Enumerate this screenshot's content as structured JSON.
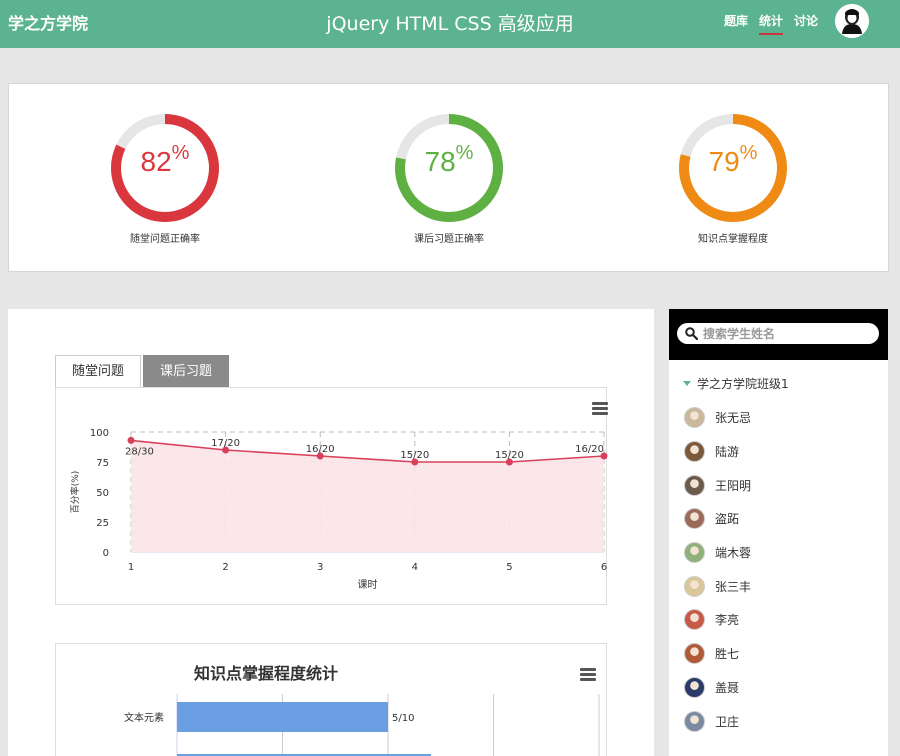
{
  "header": {
    "brand": "学之方学院",
    "title": "jQuery HTML CSS 高级应用",
    "nav": [
      {
        "label": "题库",
        "active": false
      },
      {
        "label": "统计",
        "active": true
      },
      {
        "label": "讨论",
        "active": false
      }
    ],
    "accent_color": "#5bb391"
  },
  "rings": [
    {
      "value": "82",
      "unit": "%",
      "percent": 82,
      "label": "随堂问题正确率",
      "color": "#d9363e"
    },
    {
      "value": "78",
      "unit": "%",
      "percent": 78,
      "label": "课后习题正确率",
      "color": "#5fb043"
    },
    {
      "value": "79",
      "unit": "%",
      "percent": 79,
      "label": "知识点掌握程度",
      "color": "#ef8a14"
    }
  ],
  "tabs": [
    {
      "label": "随堂问题",
      "active": true
    },
    {
      "label": "课后习题",
      "active": false
    }
  ],
  "chart_data": [
    {
      "type": "area",
      "title": "",
      "xlabel": "课时",
      "ylabel": "百分率(%)",
      "x": [
        1,
        2,
        3,
        4,
        5,
        6
      ],
      "ylim": [
        0,
        100
      ],
      "yticks": [
        0,
        25,
        50,
        75,
        100
      ],
      "grid": true,
      "series": [
        {
          "values": [
            93,
            85,
            80,
            75,
            75,
            80
          ],
          "labels": [
            "28/30",
            "17/20",
            "16/20",
            "15/20",
            "15/20",
            "16/20"
          ],
          "color": "#d9405a"
        }
      ]
    },
    {
      "type": "bar",
      "orientation": "horizontal",
      "title": "知识点掌握程度统计",
      "categories": [
        "文本元素"
      ],
      "values": [
        5
      ],
      "labels": [
        "5/10"
      ],
      "xlim": [
        0,
        10
      ],
      "color": "#6a9fe4"
    }
  ],
  "sidebar": {
    "search_placeholder": "搜索学生姓名",
    "class_name": "学之方学院班级1",
    "students": [
      "张无忌",
      "陆游",
      "王阳明",
      "盗跖",
      "端木蓉",
      "张三丰",
      "李亮",
      "胜七",
      "盖聂",
      "卫庄"
    ]
  }
}
